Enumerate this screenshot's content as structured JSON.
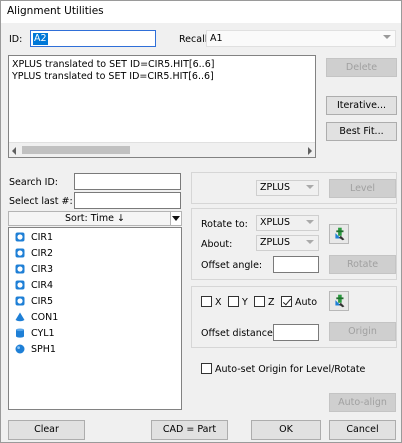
{
  "title": "Alignment Utilities",
  "id_field": {
    "label": "ID:",
    "value": "A2"
  },
  "recall": {
    "label": "Recall:",
    "value": "A1"
  },
  "log_lines": [
    "XPLUS translated to SET ID=CIR5.HIT[6..6]",
    "YPLUS translated to SET ID=CIR5.HIT[6..6]"
  ],
  "buttons": {
    "delete": "Delete",
    "iterative": "Iterative...",
    "best_fit": "Best Fit...",
    "level": "Level",
    "rotate": "Rotate",
    "origin": "Origin",
    "auto_align": "Auto-align",
    "clear": "Clear",
    "cad_part": "CAD = Part",
    "ok": "OK",
    "cancel": "Cancel"
  },
  "search": {
    "search_id_label": "Search ID:",
    "select_last_label": "Select last #:"
  },
  "sort": {
    "label": "Sort: Time ↓"
  },
  "features": [
    {
      "name": "CIR1",
      "icon": "circle-icon"
    },
    {
      "name": "CIR2",
      "icon": "circle-icon"
    },
    {
      "name": "CIR3",
      "icon": "circle-icon"
    },
    {
      "name": "CIR4",
      "icon": "circle-icon"
    },
    {
      "name": "CIR5",
      "icon": "circle-icon"
    },
    {
      "name": "CON1",
      "icon": "cone-icon"
    },
    {
      "name": "CYL1",
      "icon": "cylinder-icon"
    },
    {
      "name": "SPH1",
      "icon": "sphere-icon"
    }
  ],
  "level_group": {
    "axis": "ZPLUS"
  },
  "rotate_group": {
    "rotate_to_label": "Rotate to:",
    "rotate_to_value": "XPLUS",
    "about_label": "About:",
    "about_value": "ZPLUS",
    "offset_angle_label": "Offset angle:"
  },
  "origin_group": {
    "x_label": "X",
    "y_label": "Y",
    "z_label": "Z",
    "auto_label": "Auto",
    "x_checked": false,
    "y_checked": false,
    "z_checked": false,
    "auto_checked": true,
    "offset_distance_label": "Offset distance:"
  },
  "auto_set_origin": {
    "label": "Auto-set Origin for Level/Rotate",
    "checked": false
  },
  "colors": {
    "accent": "#0078d7",
    "icon_blue": "#1e7fd6"
  }
}
